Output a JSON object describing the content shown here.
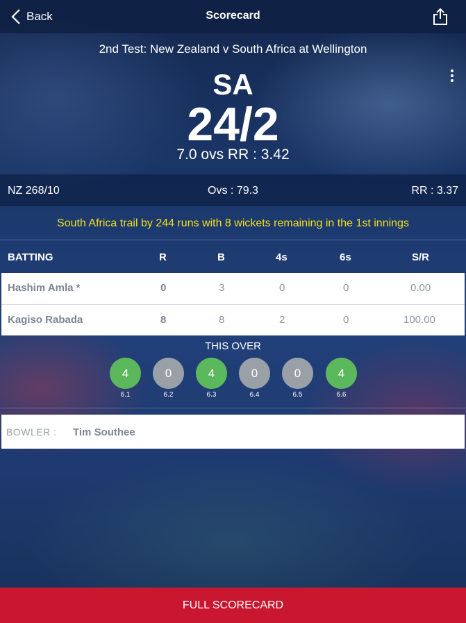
{
  "header": {
    "back_label": "Back",
    "title": "Scorecard"
  },
  "match": {
    "title": "2nd Test: New Zealand v South Africa at Wellington",
    "team": "SA",
    "score": "24/2",
    "overs_rr": "7.0 ovs  RR : 3.42"
  },
  "opponent": {
    "summary": "NZ  268/10",
    "overs": "Ovs : 79.3",
    "run_rate": "RR : 3.37"
  },
  "status_message": "South Africa trail by 244 runs with 8 wickets remaining in the 1st innings",
  "batting": {
    "headers": [
      "BATTING",
      "R",
      "B",
      "4s",
      "6s",
      "S/R"
    ],
    "rows": [
      {
        "name": "Hashim Amla *",
        "runs": "0",
        "balls": "3",
        "fours": "0",
        "sixes": "0",
        "sr": "0.00"
      },
      {
        "name": "Kagiso Rabada",
        "runs": "8",
        "balls": "8",
        "fours": "2",
        "sixes": "0",
        "sr": "100.00"
      }
    ]
  },
  "this_over": {
    "label": "THIS OVER",
    "balls": [
      {
        "runs": "4",
        "ball": "6.1",
        "type": "four"
      },
      {
        "runs": "0",
        "ball": "6.2",
        "type": "dot"
      },
      {
        "runs": "4",
        "ball": "6.3",
        "type": "four"
      },
      {
        "runs": "0",
        "ball": "6.4",
        "type": "dot"
      },
      {
        "runs": "0",
        "ball": "6.5",
        "type": "dot"
      },
      {
        "runs": "4",
        "ball": "6.6",
        "type": "four"
      }
    ]
  },
  "bowler": {
    "label": "BOWLER :",
    "name": "Tim Southee"
  },
  "footer": {
    "button_label": "FULL SCORECARD"
  },
  "colors": {
    "accent_red": "#c8172f",
    "status_yellow": "#f4df1a",
    "four_green": "#5cb85c",
    "dot_grey": "#9aa0a8"
  },
  "icons": [
    "chevron-left-icon",
    "share-icon",
    "more-vertical-icon"
  ]
}
